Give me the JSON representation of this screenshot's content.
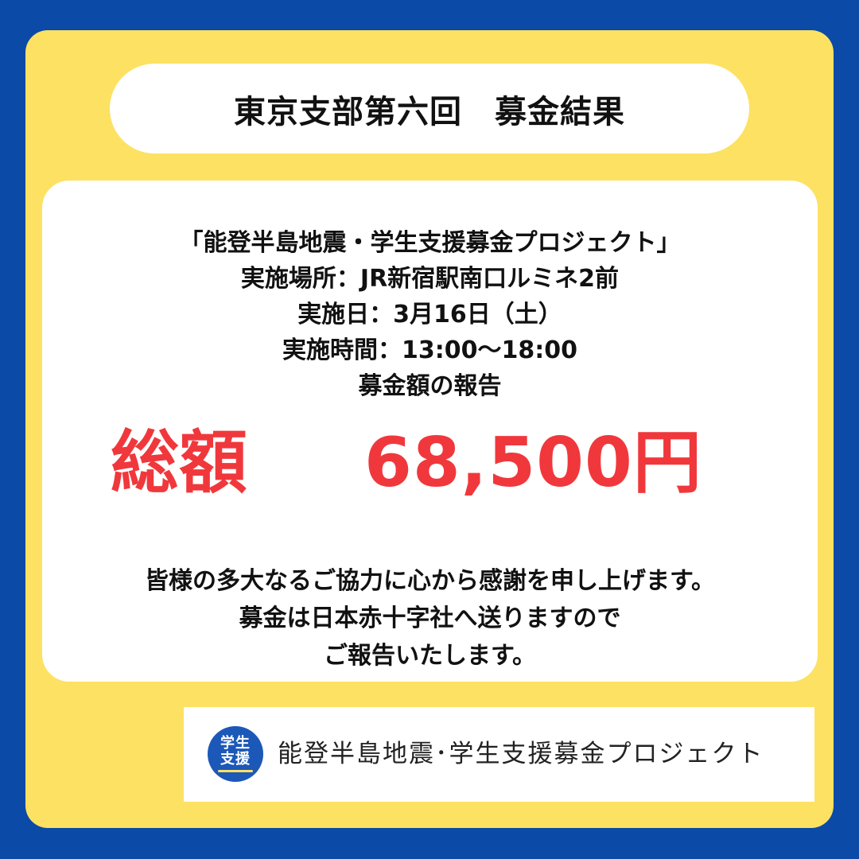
{
  "header": {
    "title": "東京支部第六回　募金結果"
  },
  "info": {
    "lines": [
      "「能登半島地震・学生支援募金プロジェクト」",
      "実施場所：JR新宿駅南口ルミネ2前",
      "実施日：3月16日（土）",
      "実施時間：13:00〜18:00",
      "募金額の報告"
    ]
  },
  "total": {
    "label": "総額",
    "amount": "68,500円"
  },
  "thanks": {
    "lines": [
      "皆様の多大なるご協力に心から感謝を申し上げます。",
      "募金は日本赤十字社へ送りますので",
      "ご報告いたします。"
    ]
  },
  "footer": {
    "logo_line1": "学生",
    "logo_line2": "支援",
    "project_name": "能登半島地震･学生支援募金プロジェクト"
  },
  "colors": {
    "background": "#0b4aa6",
    "panel": "#fde162",
    "accent_red": "#f0383c",
    "logo_blue": "#1b58b8"
  }
}
